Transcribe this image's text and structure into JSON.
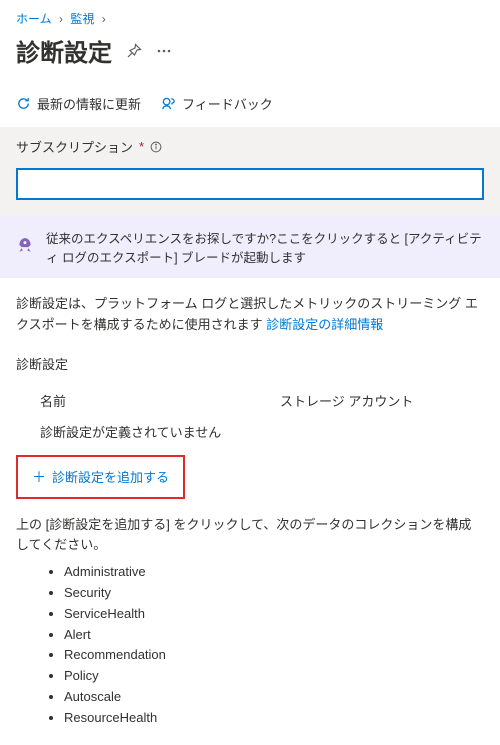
{
  "breadcrumb": {
    "home": "ホーム",
    "monitor": "監視"
  },
  "page_title": "診断設定",
  "toolbar": {
    "refresh": "最新の情報に更新",
    "feedback": "フィードバック"
  },
  "subscription": {
    "label": "サブスクリプション",
    "required_mark": "*",
    "value": ""
  },
  "notice": {
    "text": "従来のエクスペリエンスをお探しですか?ここをクリックすると [アクティビティ ログのエクスポート] ブレードが起動します"
  },
  "description": {
    "text_before_link": "診断設定は、プラットフォーム ログと選択したメトリックのストリーミング エクスポートを構成するために使用されます ",
    "link": "診断設定の詳細情報"
  },
  "diag": {
    "heading": "診断設定",
    "header_name": "名前",
    "header_storage": "ストレージ アカウント",
    "empty": "診断設定が定義されていません",
    "add_label": "診断設定を追加する"
  },
  "instruction": "上の [診断設定を追加する] をクリックして、次のデータのコレクションを構成してください。",
  "categories": [
    "Administrative",
    "Security",
    "ServiceHealth",
    "Alert",
    "Recommendation",
    "Policy",
    "Autoscale",
    "ResourceHealth"
  ]
}
